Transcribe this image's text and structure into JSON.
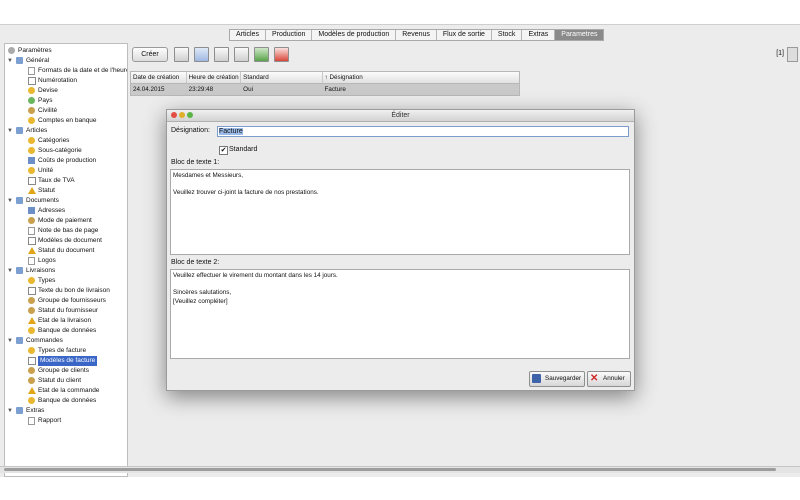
{
  "tabs": [
    "Articles",
    "Production",
    "Modèles de production",
    "Revenus",
    "Flux de sortie",
    "Stock",
    "Extras",
    "Parametres"
  ],
  "active_tab": "Parametres",
  "tree": [
    {
      "label": "Paramètres",
      "level": 0,
      "icon": "gear-icon",
      "expander": ""
    },
    {
      "label": "Général",
      "level": 1,
      "icon": "folder-icon",
      "expander": "▼"
    },
    {
      "label": "Formats de la date et de l'heure",
      "level": 2,
      "icon": "document-icon"
    },
    {
      "label": "Numérotation",
      "level": 2,
      "icon": "numbering-icon"
    },
    {
      "label": "Devise",
      "level": 2,
      "icon": "currency-icon"
    },
    {
      "label": "Pays",
      "level": 2,
      "icon": "globe-icon"
    },
    {
      "label": "Civilité",
      "level": 2,
      "icon": "person-icon"
    },
    {
      "label": "Comptes en banque",
      "level": 2,
      "icon": "bank-icon"
    },
    {
      "label": "Articles",
      "level": 1,
      "icon": "folder-icon",
      "expander": "▼"
    },
    {
      "label": "Catégories",
      "level": 2,
      "icon": "category-icon"
    },
    {
      "label": "Sous-catégorie",
      "level": 2,
      "icon": "subcategory-icon"
    },
    {
      "label": "Coûts de production",
      "level": 2,
      "icon": "cost-icon"
    },
    {
      "label": "Unité",
      "level": 2,
      "icon": "unit-icon"
    },
    {
      "label": "Taux de TVA",
      "level": 2,
      "icon": "percent-icon"
    },
    {
      "label": "Statut",
      "level": 2,
      "icon": "warning-icon"
    },
    {
      "label": "Documents",
      "level": 1,
      "icon": "folder-icon",
      "expander": "▼"
    },
    {
      "label": "Adresses",
      "level": 2,
      "icon": "address-icon"
    },
    {
      "label": "Mode de paiement",
      "level": 2,
      "icon": "payment-icon"
    },
    {
      "label": "Note de bas de page",
      "level": 2,
      "icon": "note-icon"
    },
    {
      "label": "Modèles de document",
      "level": 2,
      "icon": "template-icon"
    },
    {
      "label": "Statut du document",
      "level": 2,
      "icon": "warning-icon"
    },
    {
      "label": "Logos",
      "level": 2,
      "icon": "image-icon"
    },
    {
      "label": "Livraisons",
      "level": 1,
      "icon": "folder-icon",
      "expander": "▼"
    },
    {
      "label": "Types",
      "level": 2,
      "icon": "type-icon"
    },
    {
      "label": "Texte du bon de livraison",
      "level": 2,
      "icon": "template-icon"
    },
    {
      "label": "Groupe de fournisseurs",
      "level": 2,
      "icon": "group-icon"
    },
    {
      "label": "Statut du fournisseur",
      "level": 2,
      "icon": "person-icon"
    },
    {
      "label": "Etat de la livraison",
      "level": 2,
      "icon": "warning-icon"
    },
    {
      "label": "Banque de données",
      "level": 2,
      "icon": "database-icon"
    },
    {
      "label": "Commandes",
      "level": 1,
      "icon": "folder-icon",
      "expander": "▼"
    },
    {
      "label": "Types de facture",
      "level": 2,
      "icon": "type-icon"
    },
    {
      "label": "Modèles de facture",
      "level": 2,
      "icon": "template-icon",
      "selected": true
    },
    {
      "label": "Groupe de clients",
      "level": 2,
      "icon": "group-icon"
    },
    {
      "label": "Statut du client",
      "level": 2,
      "icon": "person-icon"
    },
    {
      "label": "Etat de la commande",
      "level": 2,
      "icon": "warning-icon"
    },
    {
      "label": "Banque de données",
      "level": 2,
      "icon": "database-icon"
    },
    {
      "label": "Extras",
      "level": 1,
      "icon": "folder-icon",
      "expander": "▼"
    },
    {
      "label": "Rapport",
      "level": 2,
      "icon": "report-icon"
    }
  ],
  "toolbar": {
    "create_label": "Créer",
    "pager": "[1]",
    "icons": [
      "new-icon",
      "copy-icon",
      "delete-icon",
      "print-icon",
      "export-icon",
      "pdf-icon"
    ]
  },
  "table": {
    "headers": [
      "Date de création",
      "Heure de création",
      "Standard",
      "↑ Désignation"
    ],
    "rows": [
      [
        "24.04.2015",
        "23:29:48",
        "Oui",
        "Facture"
      ]
    ]
  },
  "dialog": {
    "title": "Éditer",
    "designation_label": "Désignation:",
    "designation_value": "Facture",
    "standard_label": "Standard",
    "standard_checked": "✔",
    "bloc1_label": "Bloc de texte 1:",
    "bloc1_text": "Mesdames et Messieurs,\n\nVeuillez trouver ci-joint la facture de nos prestations.",
    "bloc2_label": "Bloc de texte 2:",
    "bloc2_text": "Veuillez effectuer le virement du montant dans les 14 jours.\n\nSincères salutations,\n[Veuillez compléter]",
    "save_label": "Sauvegarder",
    "cancel_label": "Annuler"
  }
}
